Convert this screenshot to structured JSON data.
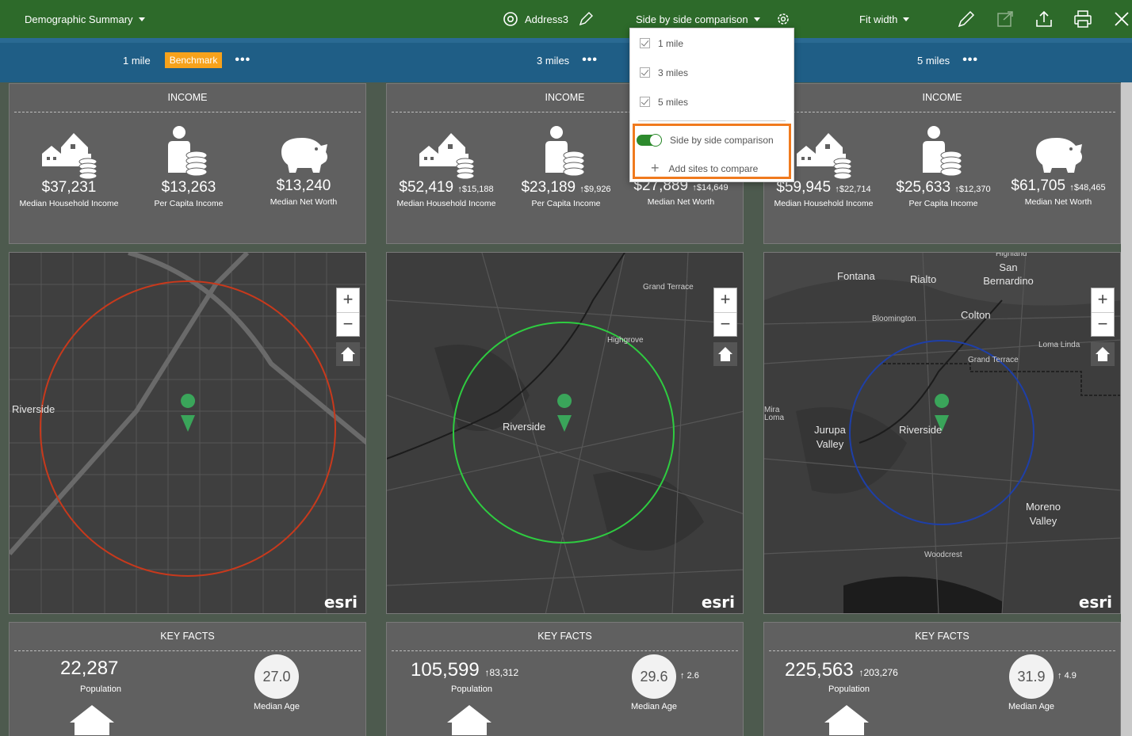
{
  "topbar": {
    "report_title": "Demographic Summary",
    "site_name": "Address3",
    "compare_label": "Side by side comparison",
    "fit_label": "Fit width"
  },
  "columns": [
    {
      "ring": "1 mile",
      "benchmark": "Benchmark",
      "income": [
        {
          "value": "$37,231",
          "delta": "",
          "label": "Median Household Income"
        },
        {
          "value": "$13,263",
          "delta": "",
          "label": "Per Capita Income"
        },
        {
          "value": "$13,240",
          "delta": "",
          "label": "Median Net Worth"
        }
      ],
      "population": "22,287",
      "population_delta": "",
      "median_age": "27.0",
      "age_delta": ""
    },
    {
      "ring": "3 miles",
      "income": [
        {
          "value": "$52,419",
          "delta": "$15,188",
          "label": "Median Household Income"
        },
        {
          "value": "$23,189",
          "delta": "$9,926",
          "label": "Per Capita Income"
        },
        {
          "value": "$27,889",
          "delta": "$14,649",
          "label": "Median Net Worth"
        }
      ],
      "population": "105,599",
      "population_delta": "83,312",
      "median_age": "29.6",
      "age_delta": "2.6"
    },
    {
      "ring": "5 miles",
      "income": [
        {
          "value": "$59,945",
          "delta": "$22,714",
          "label": "Median Household Income"
        },
        {
          "value": "$25,633",
          "delta": "$12,370",
          "label": "Per Capita Income"
        },
        {
          "value": "$61,705",
          "delta": "$48,465",
          "label": "Median Net Worth"
        }
      ],
      "population": "225,563",
      "population_delta": "203,276",
      "median_age": "31.9",
      "age_delta": "4.9"
    }
  ],
  "labels": {
    "income_title": "INCOME",
    "key_facts_title": "KEY FACTS",
    "population": "Population",
    "median_age": "Median Age",
    "esri": "esri",
    "zoom_in": "+",
    "zoom_out": "−",
    "arrow_up": "↑",
    "dots": "•••"
  },
  "map_labels": {
    "map1": [
      "Riverside"
    ],
    "map2": [
      "Grand Terrace",
      "Highgrove",
      "Riverside"
    ],
    "map3": [
      "Highland",
      "Fontana",
      "Rialto",
      "San Bernardino",
      "Bloomington",
      "Colton",
      "Loma Linda",
      "Grand Terrace",
      "Mira Loma",
      "Jurupa Valley",
      "Riverside",
      "Moreno Valley",
      "Woodcrest"
    ]
  },
  "dropdown": {
    "options": [
      "1 mile",
      "3 miles",
      "5 miles"
    ],
    "toggle_label": "Side by side comparison",
    "add_sites_label": "Add sites to compare"
  },
  "colors": {
    "topbar": "#2d6a2a",
    "subbar": "#1f5e86",
    "benchmark": "#f7a21b",
    "ring1": "#c8391c",
    "ring2": "#2ecc40",
    "ring3": "#1e3fa8",
    "highlight": "#f07a1e"
  },
  "icons": [
    "home-buildings-icon",
    "person-coins-icon",
    "piggy-bank-icon",
    "house-icon",
    "map-pin-icon",
    "home-extent-icon",
    "pencil-icon",
    "target-icon",
    "gear-icon",
    "share-icon",
    "export-icon",
    "print-icon",
    "close-icon"
  ]
}
